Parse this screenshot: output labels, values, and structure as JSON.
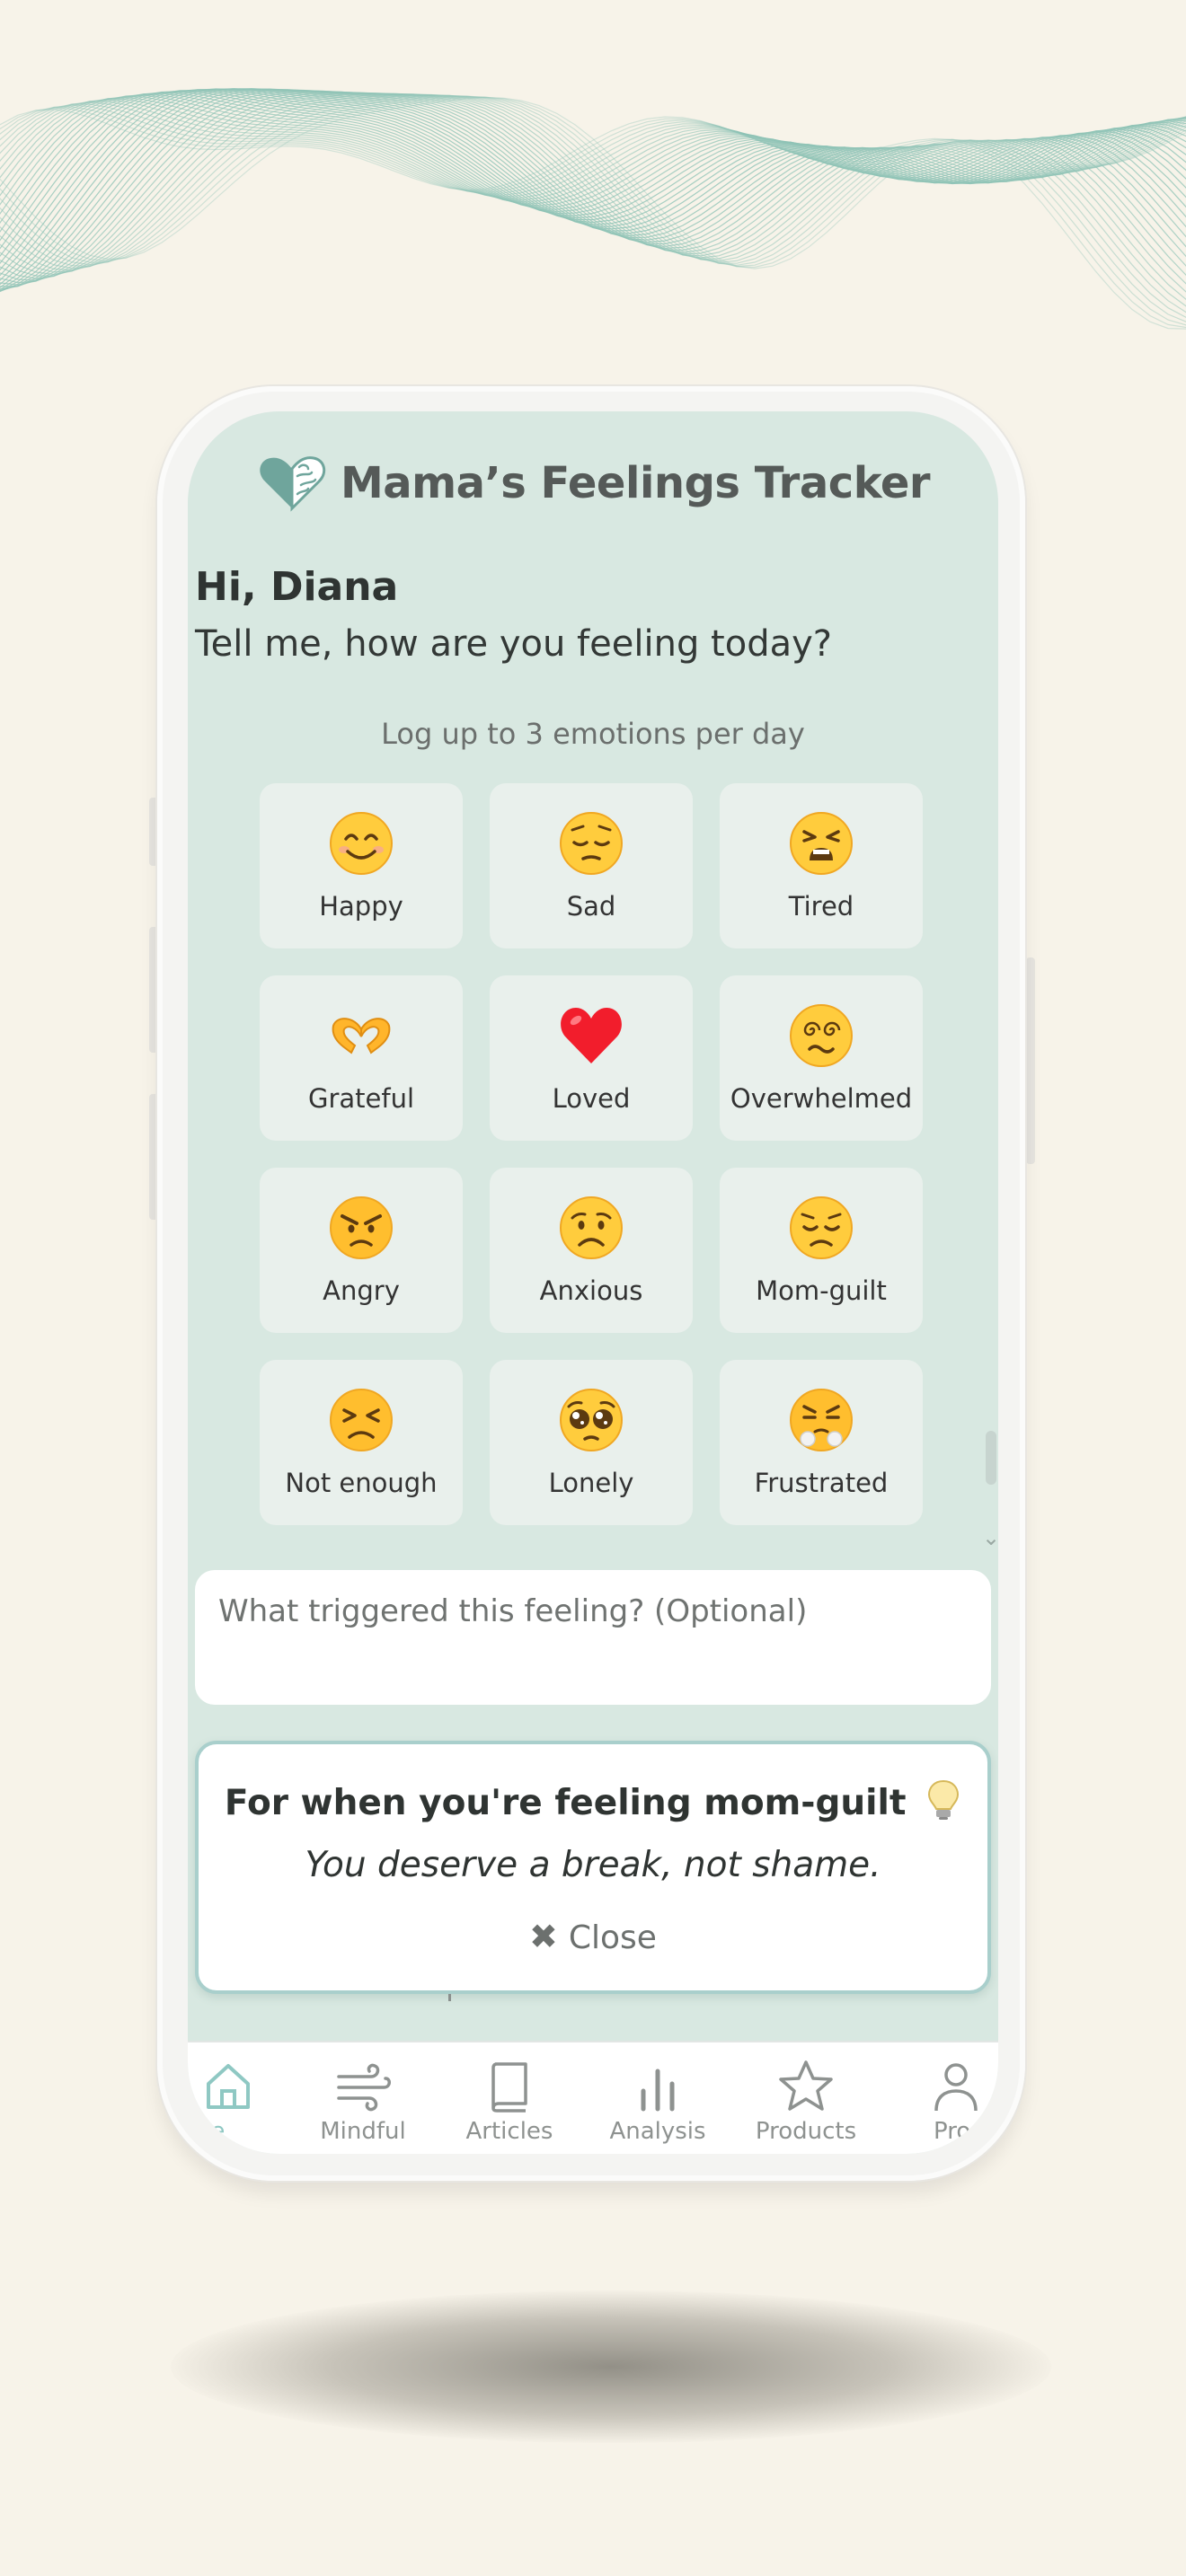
{
  "app": {
    "title": "Mama’s Feelings Tracker"
  },
  "greeting": {
    "name_line": "Hi, Diana",
    "prompt": "Tell me, how are you feeling today?"
  },
  "emotions": {
    "limit_note": "Log up to 3 emotions per day",
    "items": [
      {
        "label": "Happy",
        "icon": "smiling-face-icon"
      },
      {
        "label": "Sad",
        "icon": "pensive-face-icon"
      },
      {
        "label": "Tired",
        "icon": "tired-face-icon"
      },
      {
        "label": "Grateful",
        "icon": "heart-hands-icon"
      },
      {
        "label": "Loved",
        "icon": "red-heart-icon"
      },
      {
        "label": "Overwhelmed",
        "icon": "spiral-eyes-face-icon"
      },
      {
        "label": "Angry",
        "icon": "angry-face-icon"
      },
      {
        "label": "Anxious",
        "icon": "worried-face-icon"
      },
      {
        "label": "Mom-guilt",
        "icon": "disappointed-face-icon"
      },
      {
        "label": "Not enough",
        "icon": "persevering-face-icon"
      },
      {
        "label": "Lonely",
        "icon": "pleading-face-icon"
      },
      {
        "label": "Frustrated",
        "icon": "steam-nose-face-icon"
      }
    ]
  },
  "trigger": {
    "placeholder": "What triggered this feeling? (Optional)",
    "value": ""
  },
  "tip": {
    "title": "For when you're feeling mom-guilt",
    "message": "You deserve a break, not shame.",
    "close_label": "Close"
  },
  "tabs": [
    {
      "label": "Home",
      "visible_label": "me",
      "icon": "home-icon",
      "active": true
    },
    {
      "label": "Mindful",
      "icon": "wind-icon",
      "active": false
    },
    {
      "label": "Articles",
      "icon": "book-icon",
      "active": false
    },
    {
      "label": "Analysis",
      "icon": "bar-chart-icon",
      "active": false
    },
    {
      "label": "Products",
      "icon": "star-icon",
      "active": false
    },
    {
      "label": "Profile",
      "visible_label": "Pro",
      "icon": "person-icon",
      "active": false
    }
  ],
  "colors": {
    "page_background": "#f7f3e9",
    "screen_background": "#d8e8e1",
    "tile_background": "#e9f0ec",
    "accent": "#8fc8c3",
    "wave": "#8fc3b6"
  }
}
